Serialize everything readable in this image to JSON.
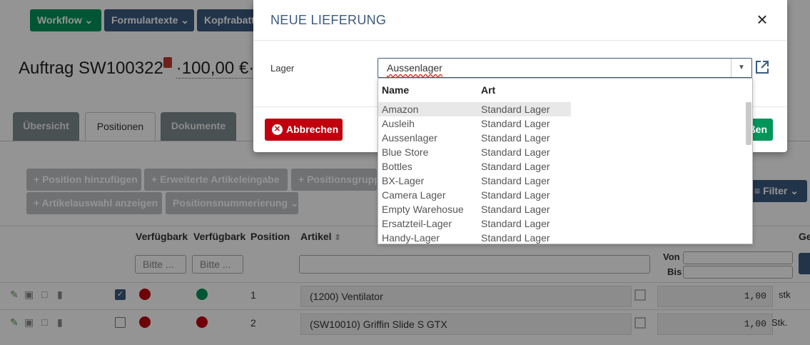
{
  "toolbar": {
    "workflow": "Workflow",
    "formulartexte": "Formulartexte",
    "kopfrabatt": "Kopfrabatt",
    "colors": {
      "workflow": "#00955b",
      "formulartexte": "#3c5a80",
      "kopfrabatt": "#3c5a80"
    }
  },
  "order": {
    "title": "Auftrag SW100322",
    "amount": "·100,00 €·"
  },
  "tabs": [
    {
      "label": "Übersicht",
      "active": false
    },
    {
      "label": "Positionen",
      "active": true
    },
    {
      "label": "Dokumente",
      "active": false
    }
  ],
  "actions": {
    "add_position": "+ Position hinzufügen",
    "extended_entry": "+ Erweiterte Artikeleingabe",
    "position_group": "+ Positionsgrupp",
    "show_article_selection": "+ Artikelauswahl anzeigen",
    "numbering": "Positionsnummerierung",
    "filter": "Filter"
  },
  "table": {
    "headers": [
      "Verfügbark",
      "Verfügbark",
      "Position",
      "Artikel",
      "Ge"
    ],
    "filter_placeholder": "Bitte ...",
    "von": "Von",
    "bis": "Bis",
    "rows": [
      {
        "checked": true,
        "dot1": "red",
        "dot2": "green",
        "position": "1",
        "article": "(1200) Ventilator",
        "qty": "1,00",
        "unit": "stk"
      },
      {
        "checked": false,
        "dot1": "red",
        "dot2": "red",
        "position": "2",
        "article": "(SW10010) Griffin Slide S GTX",
        "qty": "1,00",
        "unit": "Stk."
      }
    ]
  },
  "modal": {
    "title": "NEUE LIEFERUNG",
    "lager_label": "Lager",
    "lager_value": "Aussenlager",
    "cancel_label": "Abbrechen",
    "save_label_visible": "ßen",
    "dropdown": {
      "col_name": "Name",
      "col_art": "Art",
      "options": [
        {
          "name": "Amazon",
          "art": "Standard Lager"
        },
        {
          "name": "Ausleih",
          "art": "Standard Lager"
        },
        {
          "name": "Aussenlager",
          "art": "Standard Lager"
        },
        {
          "name": "Blue Store",
          "art": "Standard Lager"
        },
        {
          "name": "Bottles",
          "art": "Standard Lager"
        },
        {
          "name": "BX-Lager",
          "art": "Standard Lager"
        },
        {
          "name": "Camera Lager",
          "art": "Standard Lager"
        },
        {
          "name": "Empty Warehosue",
          "art": "Standard Lager"
        },
        {
          "name": "Ersatzteil-Lager",
          "art": "Standard Lager"
        },
        {
          "name": "Handy-Lager",
          "art": "Standard Lager"
        }
      ]
    }
  }
}
